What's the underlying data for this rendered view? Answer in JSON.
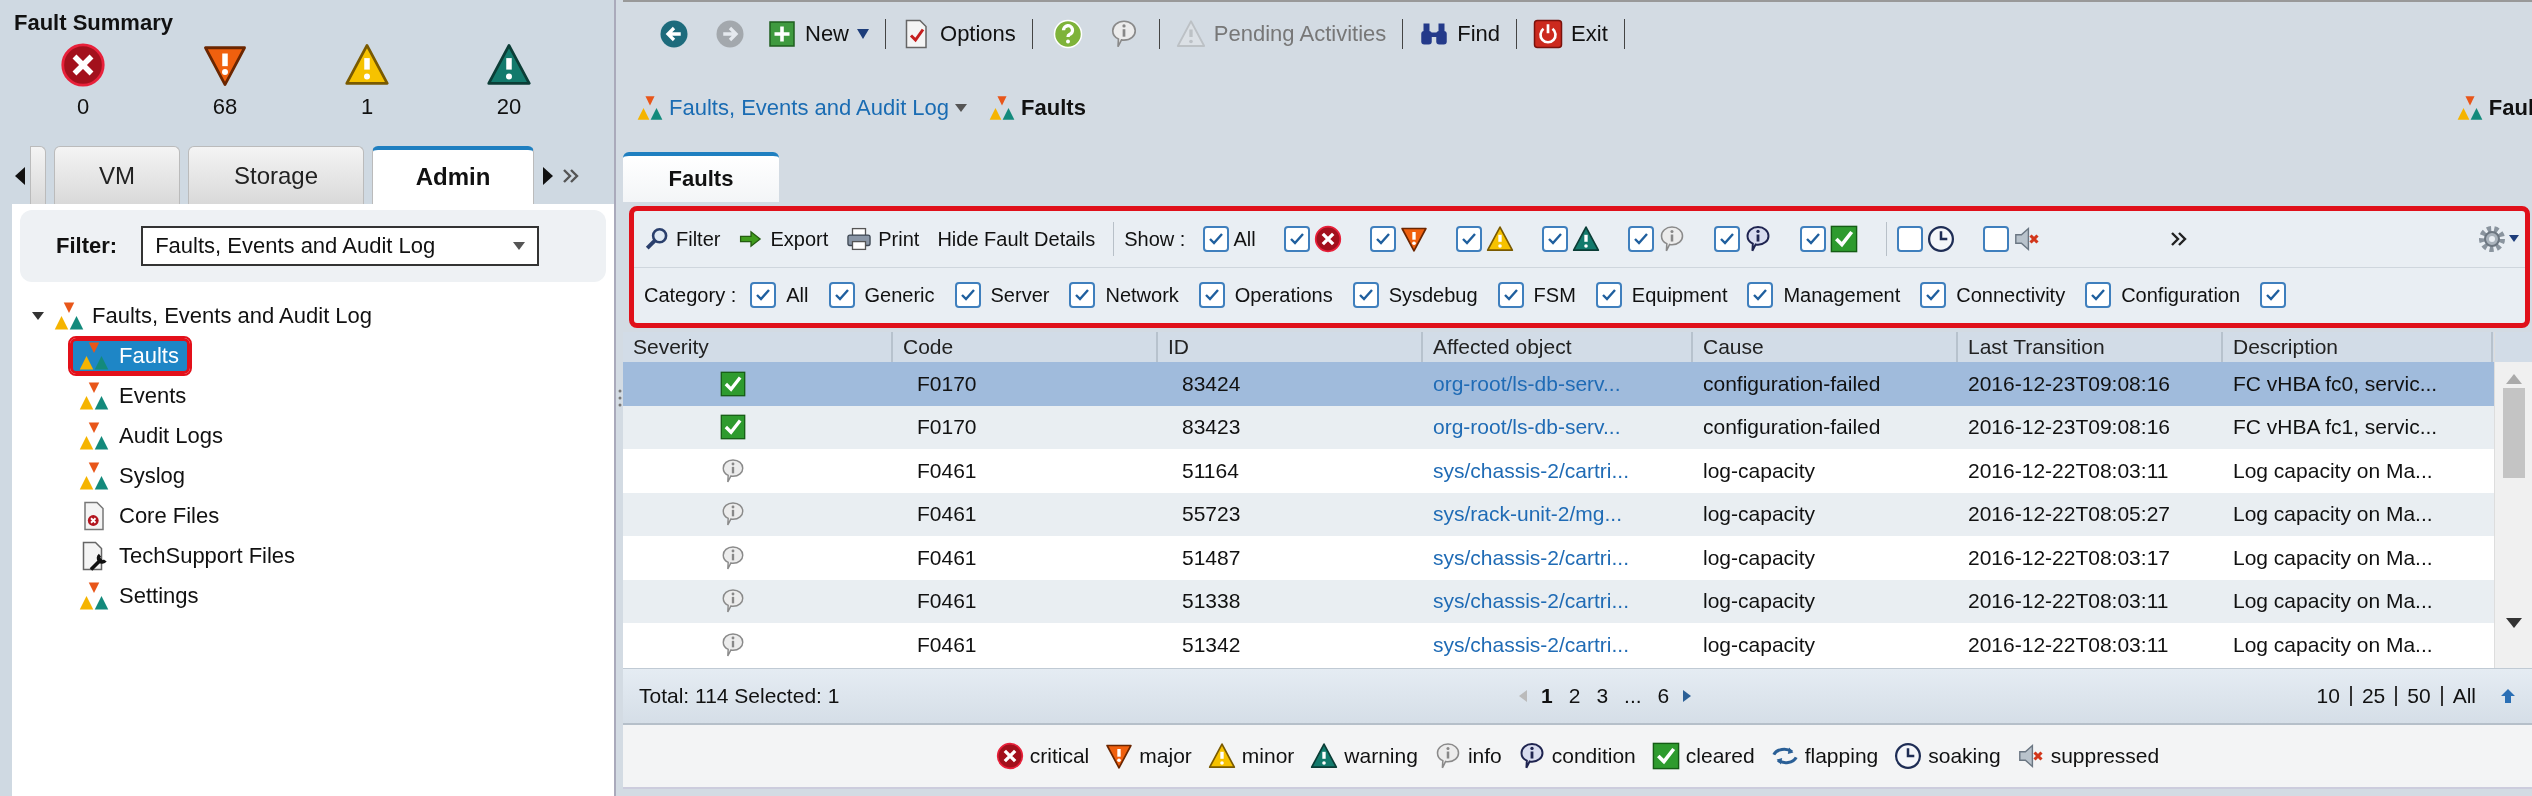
{
  "fault_summary": {
    "title": "Fault Summary",
    "counts": [
      {
        "kind": "critical",
        "count": "0"
      },
      {
        "kind": "major",
        "count": "68"
      },
      {
        "kind": "minor",
        "count": "1"
      },
      {
        "kind": "warning",
        "count": "20"
      }
    ]
  },
  "nav_tabs": [
    {
      "label": "VM",
      "selected": false
    },
    {
      "label": "Storage",
      "selected": false
    },
    {
      "label": "Admin",
      "selected": true
    }
  ],
  "filter": {
    "label": "Filter:",
    "value": "Faults, Events and Audit Log"
  },
  "tree": {
    "label": "Faults, Events and Audit Log",
    "expanded": true,
    "children": [
      {
        "label": "Faults",
        "kind": "faults",
        "selected": true
      },
      {
        "label": "Events",
        "kind": "faults",
        "selected": false
      },
      {
        "label": "Audit Logs",
        "kind": "faults",
        "selected": false
      },
      {
        "label": "Syslog",
        "kind": "faults",
        "selected": false
      },
      {
        "label": "Core Files",
        "kind": "corefile",
        "selected": false
      },
      {
        "label": "TechSupport Files",
        "kind": "techsupport",
        "selected": false
      },
      {
        "label": "Settings",
        "kind": "faults",
        "selected": false
      }
    ]
  },
  "toolbar": {
    "groups": [
      [
        {
          "kind": "back",
          "disabled": false
        },
        {
          "kind": "forward",
          "disabled": true
        },
        {
          "kind": "new",
          "label": "New",
          "disabled": false
        }
      ],
      [
        {
          "kind": "options",
          "label": "Options",
          "disabled": false
        }
      ],
      [
        {
          "kind": "help",
          "disabled": false
        },
        {
          "kind": "info",
          "disabled": false
        }
      ],
      [
        {
          "kind": "pending",
          "label": "Pending Activities",
          "disabled": true
        }
      ],
      [
        {
          "kind": "find",
          "label": "Find",
          "disabled": false
        }
      ],
      [
        {
          "kind": "exit",
          "label": "Exit",
          "disabled": false
        }
      ]
    ]
  },
  "breadcrumb": {
    "items": [
      {
        "label": "Faults, Events and Audit Log",
        "kind": "link"
      },
      {
        "label": "Faults",
        "kind": "current"
      }
    ],
    "right_label": "Faul"
  },
  "content_tabs": [
    {
      "label": "Faults",
      "selected": true
    }
  ],
  "actions": [
    {
      "kind": "filter",
      "label": "Filter"
    },
    {
      "kind": "export",
      "label": "Export"
    },
    {
      "kind": "print",
      "label": "Print"
    },
    {
      "kind": "plain",
      "label": "Hide Fault Details"
    }
  ],
  "show": {
    "label": "Show :",
    "options": [
      {
        "kind": "all",
        "label": "All",
        "checked": true
      },
      {
        "kind": "critical",
        "checked": true
      },
      {
        "kind": "major",
        "checked": true
      },
      {
        "kind": "minor",
        "checked": true
      },
      {
        "kind": "warning",
        "checked": true
      },
      {
        "kind": "info",
        "checked": true
      },
      {
        "kind": "condition",
        "checked": true
      },
      {
        "kind": "cleared",
        "checked": true
      },
      {
        "kind": "soaking",
        "checked": false
      },
      {
        "kind": "suppressed",
        "checked": false
      }
    ]
  },
  "category": {
    "label": "Category :",
    "options": [
      {
        "label": "All",
        "checked": true
      },
      {
        "label": "Generic",
        "checked": true
      },
      {
        "label": "Server",
        "checked": true
      },
      {
        "label": "Network",
        "checked": true
      },
      {
        "label": "Operations",
        "checked": true
      },
      {
        "label": "Sysdebug",
        "checked": true
      },
      {
        "label": "FSM",
        "checked": true
      },
      {
        "label": "Equipment",
        "checked": true
      },
      {
        "label": "Management",
        "checked": true
      },
      {
        "label": "Connectivity",
        "checked": true
      },
      {
        "label": "Configuration",
        "checked": true
      },
      {
        "checked": true
      }
    ]
  },
  "table": {
    "columns": [
      "Severity",
      "Code",
      "ID",
      "Affected object",
      "Cause",
      "Last Transition",
      "Description"
    ],
    "rows": [
      {
        "kind": "cleared",
        "selected": true,
        "cells": [
          "",
          "F0170",
          "83424",
          "org-root/ls-db-serv...",
          "configuration-failed",
          "2016-12-23T09:08:16",
          "FC vHBA fc0, servic..."
        ]
      },
      {
        "kind": "cleared",
        "selected": false,
        "cells": [
          "",
          "F0170",
          "83423",
          "org-root/ls-db-serv...",
          "configuration-failed",
          "2016-12-23T09:08:16",
          "FC vHBA fc1, servic..."
        ]
      },
      {
        "kind": "info",
        "selected": false,
        "cells": [
          "",
          "F0461",
          "51164",
          "sys/chassis-2/cartri...",
          "log-capacity",
          "2016-12-22T08:03:11",
          "Log capacity on Ma..."
        ]
      },
      {
        "kind": "info",
        "selected": false,
        "cells": [
          "",
          "F0461",
          "55723",
          "sys/rack-unit-2/mg...",
          "log-capacity",
          "2016-12-22T08:05:27",
          "Log capacity on Ma..."
        ]
      },
      {
        "kind": "info",
        "selected": false,
        "cells": [
          "",
          "F0461",
          "51487",
          "sys/chassis-2/cartri...",
          "log-capacity",
          "2016-12-22T08:03:17",
          "Log capacity on Ma..."
        ]
      },
      {
        "kind": "info",
        "selected": false,
        "cells": [
          "",
          "F0461",
          "51338",
          "sys/chassis-2/cartri...",
          "log-capacity",
          "2016-12-22T08:03:11",
          "Log capacity on Ma..."
        ]
      },
      {
        "kind": "info",
        "selected": false,
        "cells": [
          "",
          "F0461",
          "51342",
          "sys/chassis-2/cartri...",
          "log-capacity",
          "2016-12-22T08:03:11",
          "Log capacity on Ma..."
        ]
      }
    ]
  },
  "pager": {
    "summary": "Total: 114 Selected: 1",
    "pages": [
      {
        "label": "1",
        "selected": true
      },
      {
        "label": "2",
        "selected": false
      },
      {
        "label": "3",
        "selected": false
      },
      {
        "label": "...",
        "selected": false
      },
      {
        "label": "6",
        "selected": false
      }
    ],
    "sizes": [
      "10",
      "25",
      "50",
      "All"
    ]
  },
  "legend": [
    {
      "kind": "critical",
      "label": "critical"
    },
    {
      "kind": "major",
      "label": "major"
    },
    {
      "kind": "minor",
      "label": "minor"
    },
    {
      "kind": "warning",
      "label": "warning"
    },
    {
      "kind": "info",
      "label": "info"
    },
    {
      "kind": "condition",
      "label": "condition"
    },
    {
      "kind": "cleared",
      "label": "cleared"
    },
    {
      "kind": "flapping",
      "label": "flapping"
    },
    {
      "kind": "soaking",
      "label": "soaking"
    },
    {
      "kind": "suppressed",
      "label": "suppressed"
    }
  ]
}
